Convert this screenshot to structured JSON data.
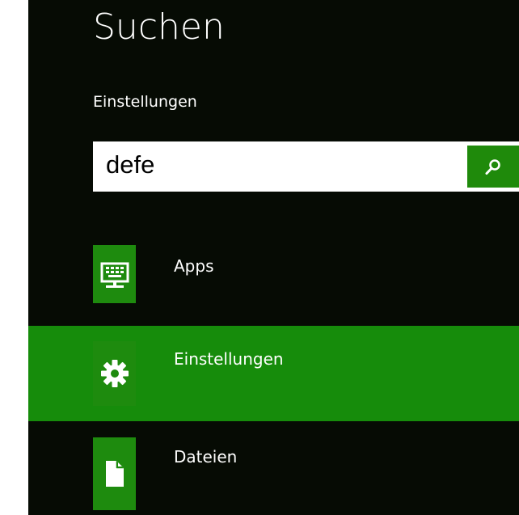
{
  "search": {
    "title": "Suchen",
    "scope_label": "Einstellungen",
    "query": "defe",
    "button_icon": "search-icon"
  },
  "results": [
    {
      "label": "Apps",
      "icon": "keyboard-monitor-icon",
      "selected": false
    },
    {
      "label": "Einstellungen",
      "icon": "gear-icon",
      "selected": true
    },
    {
      "label": "Dateien",
      "icon": "document-icon",
      "selected": false
    }
  ],
  "colors": {
    "background": "#060b04",
    "accent": "#1f8a0b",
    "selected_row": "#168c0b",
    "text": "#ffffff"
  }
}
